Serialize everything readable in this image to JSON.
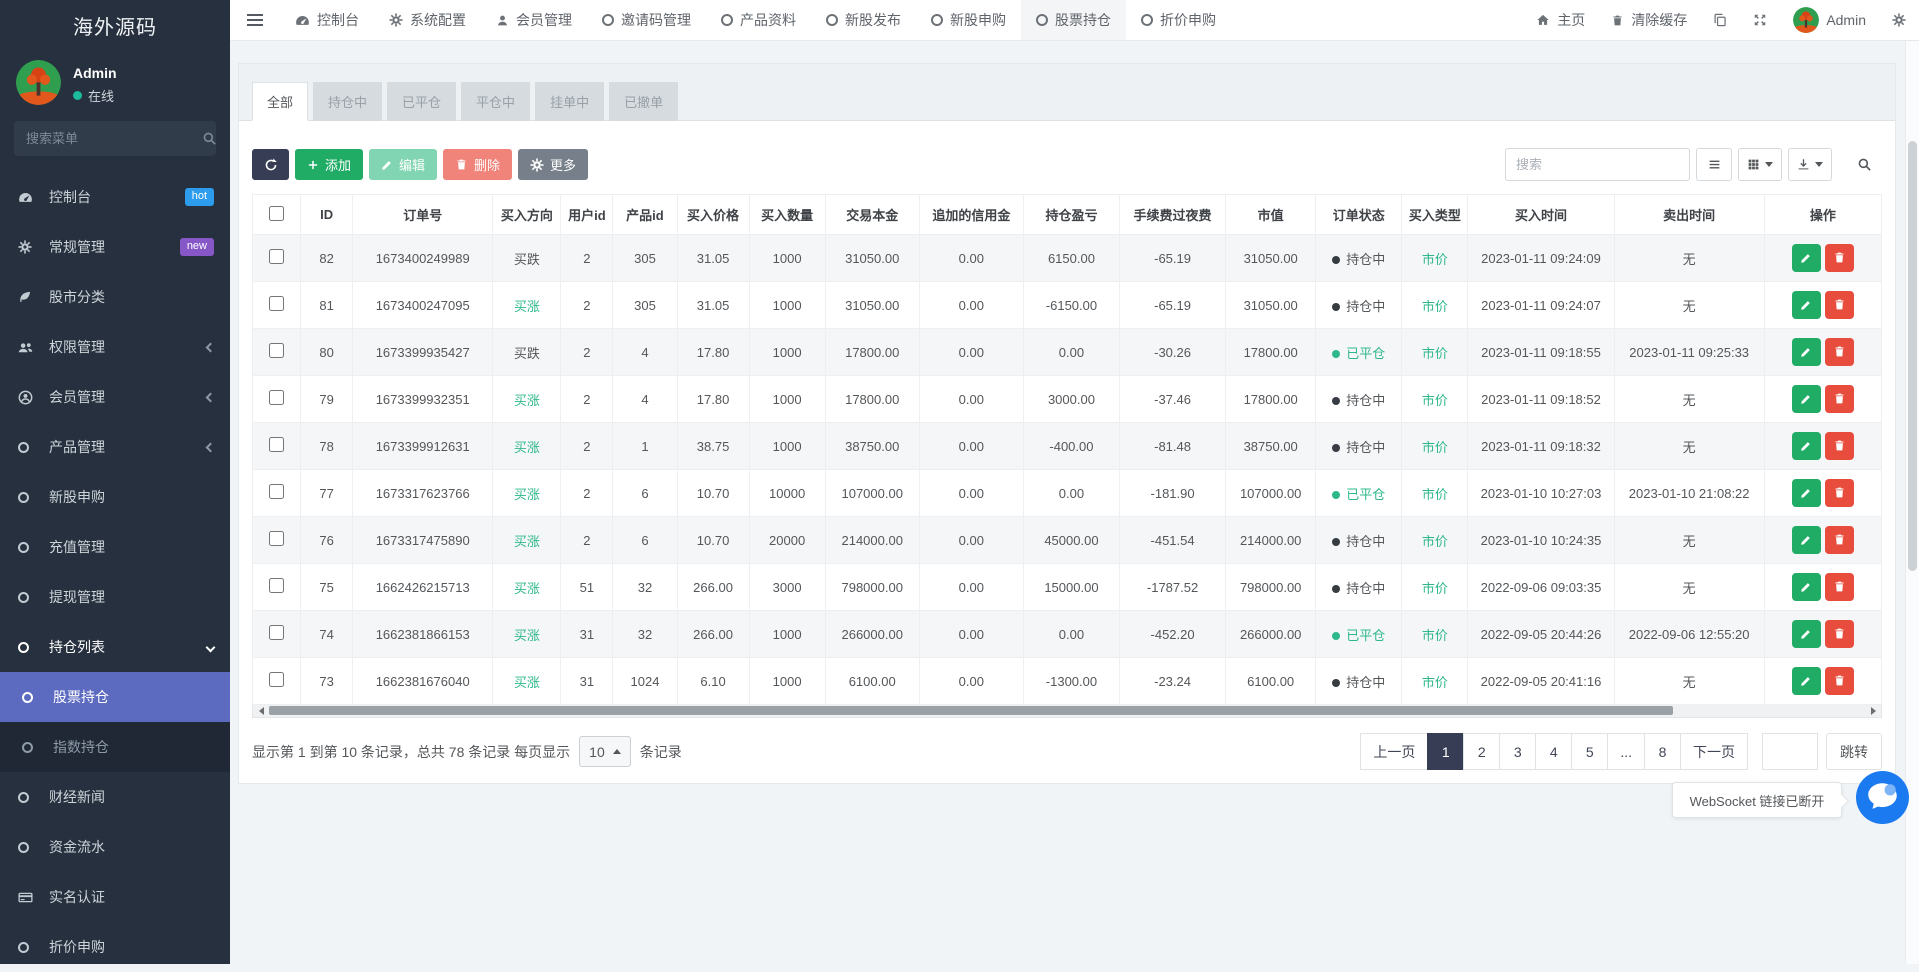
{
  "colors": {
    "accent_indigo": "#5c6bc0",
    "green": "#2eb88a",
    "btn_green": "#21ac66",
    "btn_green_light": "#82d5b2",
    "btn_red_light": "#f0837a",
    "btn_gray": "#77808a",
    "btn_dark": "#363d55",
    "red": "#e74c3c",
    "badge_hot": "#2d9cec",
    "badge_new": "#8757c8",
    "online_green": "#1abc9c",
    "chat_blue": "#1b7af0"
  },
  "brand": "海外源码",
  "user": {
    "name": "Admin",
    "status": "在线"
  },
  "sidebar": {
    "search_placeholder": "搜索菜单",
    "items": [
      {
        "key": "dashboard",
        "label": "控制台",
        "icon": "gauge",
        "badge": "hot",
        "badge_color": "#2d9cec"
      },
      {
        "key": "general-mgmt",
        "label": "常规管理",
        "icon": "gear",
        "badge": "new",
        "badge_color": "#8757c8"
      },
      {
        "key": "market-category",
        "label": "股市分类",
        "icon": "leaf"
      },
      {
        "key": "permission-mgmt",
        "label": "权限管理",
        "icon": "users",
        "arrow": "left"
      },
      {
        "key": "member-mgmt",
        "label": "会员管理",
        "icon": "user-circle",
        "arrow": "left"
      },
      {
        "key": "product-mgmt",
        "label": "产品管理",
        "icon": "circle",
        "arrow": "left"
      },
      {
        "key": "ipo-subscribe",
        "label": "新股申购",
        "icon": "circle"
      },
      {
        "key": "recharge-mgmt",
        "label": "充值管理",
        "icon": "circle"
      },
      {
        "key": "withdraw-mgmt",
        "label": "提现管理",
        "icon": "circle"
      },
      {
        "key": "position-list",
        "label": "持仓列表",
        "icon": "circle",
        "arrow": "down",
        "open": true,
        "children": [
          {
            "key": "stock-position",
            "label": "股票持仓",
            "icon": "circle",
            "active": true
          },
          {
            "key": "index-position",
            "label": "指数持仓",
            "icon": "circle"
          }
        ]
      },
      {
        "key": "finance-news",
        "label": "财经新闻",
        "icon": "circle"
      },
      {
        "key": "fund-flow",
        "label": "资金流水",
        "icon": "circle"
      },
      {
        "key": "real-name-auth",
        "label": "实名认证",
        "icon": "card"
      },
      {
        "key": "discount-subscribe",
        "label": "折价申购",
        "icon": "circle"
      }
    ]
  },
  "navbar": {
    "items": [
      {
        "key": "dashboard",
        "label": "控制台",
        "icon": "gauge"
      },
      {
        "key": "system-config",
        "label": "系统配置",
        "icon": "gear"
      },
      {
        "key": "member-mgmt",
        "label": "会员管理",
        "icon": "person"
      },
      {
        "key": "invite-code",
        "label": "邀请码管理",
        "icon": "circle"
      },
      {
        "key": "product-info",
        "label": "产品资料",
        "icon": "circle"
      },
      {
        "key": "ipo-publish",
        "label": "新股发布",
        "icon": "circle"
      },
      {
        "key": "ipo-subscribe",
        "label": "新股申购",
        "icon": "circle"
      },
      {
        "key": "stock-position",
        "label": "股票持仓",
        "icon": "circle",
        "active": true
      },
      {
        "key": "discount-subscribe",
        "label": "折价申购",
        "icon": "circle"
      }
    ],
    "right": {
      "home": "主页",
      "clear_cache": "清除缓存",
      "user": "Admin"
    }
  },
  "tabs": [
    {
      "label": "全部",
      "active": true
    },
    {
      "label": "持仓中"
    },
    {
      "label": "已平仓"
    },
    {
      "label": "平仓中"
    },
    {
      "label": "挂单中"
    },
    {
      "label": "已撤单"
    }
  ],
  "toolbar": {
    "add": "添加",
    "edit": "编辑",
    "delete": "删除",
    "more": "更多",
    "search_placeholder": "搜索"
  },
  "table": {
    "headers": [
      "ID",
      "订单号",
      "买入方向",
      "用户id",
      "产品id",
      "买入价格",
      "买入数量",
      "交易本金",
      "追加的信用金",
      "持仓盈亏",
      "手续费过夜费",
      "市值",
      "订单状态",
      "买入类型",
      "买入时间",
      "卖出时间",
      "操作"
    ],
    "rows": [
      {
        "id": "82",
        "order_no": "1673400249989",
        "direction": "买跌",
        "direction_up": false,
        "user_id": "2",
        "product_id": "305",
        "price": "31.05",
        "quantity": "1000",
        "principal": "31050.00",
        "credit": "0.00",
        "pnl": "6150.00",
        "fee": "-65.19",
        "market_value": "31050.00",
        "status": "持仓中",
        "closed": false,
        "buy_type": "市价",
        "buy_time": "2023-01-11 09:24:09",
        "sell_time": "无"
      },
      {
        "id": "81",
        "order_no": "1673400247095",
        "direction": "买涨",
        "direction_up": true,
        "user_id": "2",
        "product_id": "305",
        "price": "31.05",
        "quantity": "1000",
        "principal": "31050.00",
        "credit": "0.00",
        "pnl": "-6150.00",
        "fee": "-65.19",
        "market_value": "31050.00",
        "status": "持仓中",
        "closed": false,
        "buy_type": "市价",
        "buy_time": "2023-01-11 09:24:07",
        "sell_time": "无"
      },
      {
        "id": "80",
        "order_no": "1673399935427",
        "direction": "买跌",
        "direction_up": false,
        "user_id": "2",
        "product_id": "4",
        "price": "17.80",
        "quantity": "1000",
        "principal": "17800.00",
        "credit": "0.00",
        "pnl": "0.00",
        "fee": "-30.26",
        "market_value": "17800.00",
        "status": "已平仓",
        "closed": true,
        "buy_type": "市价",
        "buy_time": "2023-01-11 09:18:55",
        "sell_time": "2023-01-11 09:25:33"
      },
      {
        "id": "79",
        "order_no": "1673399932351",
        "direction": "买涨",
        "direction_up": true,
        "user_id": "2",
        "product_id": "4",
        "price": "17.80",
        "quantity": "1000",
        "principal": "17800.00",
        "credit": "0.00",
        "pnl": "3000.00",
        "fee": "-37.46",
        "market_value": "17800.00",
        "status": "持仓中",
        "closed": false,
        "buy_type": "市价",
        "buy_time": "2023-01-11 09:18:52",
        "sell_time": "无"
      },
      {
        "id": "78",
        "order_no": "1673399912631",
        "direction": "买涨",
        "direction_up": true,
        "user_id": "2",
        "product_id": "1",
        "price": "38.75",
        "quantity": "1000",
        "principal": "38750.00",
        "credit": "0.00",
        "pnl": "-400.00",
        "fee": "-81.48",
        "market_value": "38750.00",
        "status": "持仓中",
        "closed": false,
        "buy_type": "市价",
        "buy_time": "2023-01-11 09:18:32",
        "sell_time": "无"
      },
      {
        "id": "77",
        "order_no": "1673317623766",
        "direction": "买涨",
        "direction_up": true,
        "user_id": "2",
        "product_id": "6",
        "price": "10.70",
        "quantity": "10000",
        "principal": "107000.00",
        "credit": "0.00",
        "pnl": "0.00",
        "fee": "-181.90",
        "market_value": "107000.00",
        "status": "已平仓",
        "closed": true,
        "buy_type": "市价",
        "buy_time": "2023-01-10 10:27:03",
        "sell_time": "2023-01-10 21:08:22"
      },
      {
        "id": "76",
        "order_no": "1673317475890",
        "direction": "买涨",
        "direction_up": true,
        "user_id": "2",
        "product_id": "6",
        "price": "10.70",
        "quantity": "20000",
        "principal": "214000.00",
        "credit": "0.00",
        "pnl": "45000.00",
        "fee": "-451.54",
        "market_value": "214000.00",
        "status": "持仓中",
        "closed": false,
        "buy_type": "市价",
        "buy_time": "2023-01-10 10:24:35",
        "sell_time": "无"
      },
      {
        "id": "75",
        "order_no": "1662426215713",
        "direction": "买涨",
        "direction_up": true,
        "user_id": "51",
        "product_id": "32",
        "price": "266.00",
        "quantity": "3000",
        "principal": "798000.00",
        "credit": "0.00",
        "pnl": "15000.00",
        "fee": "-1787.52",
        "market_value": "798000.00",
        "status": "持仓中",
        "closed": false,
        "buy_type": "市价",
        "buy_time": "2022-09-06 09:03:35",
        "sell_time": "无"
      },
      {
        "id": "74",
        "order_no": "1662381866153",
        "direction": "买涨",
        "direction_up": true,
        "user_id": "31",
        "product_id": "32",
        "price": "266.00",
        "quantity": "1000",
        "principal": "266000.00",
        "credit": "0.00",
        "pnl": "0.00",
        "fee": "-452.20",
        "market_value": "266000.00",
        "status": "已平仓",
        "closed": true,
        "buy_type": "市价",
        "buy_time": "2022-09-05 20:44:26",
        "sell_time": "2022-09-06 12:55:20"
      },
      {
        "id": "73",
        "order_no": "1662381676040",
        "direction": "买涨",
        "direction_up": true,
        "user_id": "31",
        "product_id": "1024",
        "price": "6.10",
        "quantity": "1000",
        "principal": "6100.00",
        "credit": "0.00",
        "pnl": "-1300.00",
        "fee": "-23.24",
        "market_value": "6100.00",
        "status": "持仓中",
        "closed": false,
        "buy_type": "市价",
        "buy_time": "2022-09-05 20:41:16",
        "sell_time": "无"
      }
    ]
  },
  "footer": {
    "summary_prefix": "显示第 1 到第 10 条记录，总共 78 条记录 每页显示",
    "page_size": "10",
    "summary_suffix": "条记录",
    "pages": [
      {
        "label": "上一页"
      },
      {
        "label": "1",
        "active": true
      },
      {
        "label": "2"
      },
      {
        "label": "3"
      },
      {
        "label": "4"
      },
      {
        "label": "5"
      },
      {
        "label": "..."
      },
      {
        "label": "8"
      },
      {
        "label": "下一页"
      }
    ],
    "jump_label": "跳转"
  },
  "tooltip": {
    "text": "WebSocket 链接已断开"
  }
}
